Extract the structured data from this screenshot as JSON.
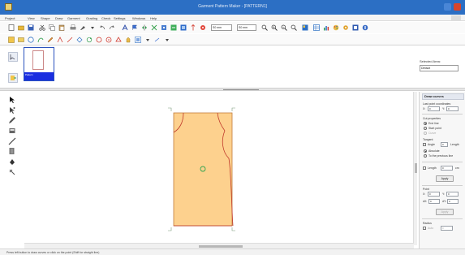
{
  "window": {
    "title": "Garment Pattern Maker - [PATTERN1]"
  },
  "menu": [
    "Project",
    "View",
    "Shape",
    "Draw",
    "Garment",
    "Grading",
    "Check",
    "Settings",
    "Windows",
    "Help"
  ],
  "toolbar": {
    "combo1": "S0 mm",
    "combo2": "S0 mm"
  },
  "thumbnail": {
    "label": "Pattern"
  },
  "selected_area": {
    "label": "Selected Area:",
    "value": "Default"
  },
  "panel": {
    "heading": "Draw curves",
    "last_point": "Last point coordinates",
    "x_label": "X:",
    "x_value": "0",
    "y_label": "Y:",
    "y_value": "0",
    "cut_props": "Cut properties",
    "opt_end_line": "End line",
    "opt_start_point": "Start point",
    "opt_disabled": "Curve",
    "tangent_label": "Tangent",
    "tangent_angle": "Angle",
    "tangent_value": "0",
    "tangent_length": "Length",
    "opt_absolute": "Absolute",
    "opt_relative": "To the previous line",
    "length_label": "Length",
    "length_value": "0",
    "length_unit": "cm",
    "apply1": "Apply",
    "point_label": "Point",
    "px_label": "X:",
    "px_value": "0",
    "py_label": "Y:",
    "py_value": "0",
    "dx_label": "dX:",
    "dx_value": "0",
    "dy_label": "dY:",
    "dy_value": "0",
    "apply2": "Apply",
    "radius_label": "Radius",
    "radius_opt": "Auto",
    "radius_value": "0"
  },
  "status": {
    "text": "Press left button to draw curves or click on the point (Shift for straight line)"
  },
  "colors": {
    "pattern_fill": "#fdd18e",
    "pattern_stroke": "#c0392b",
    "titlebar": "#2c6fc4",
    "selection": "#1a2ee0",
    "center_marker": "#2ea44f"
  }
}
